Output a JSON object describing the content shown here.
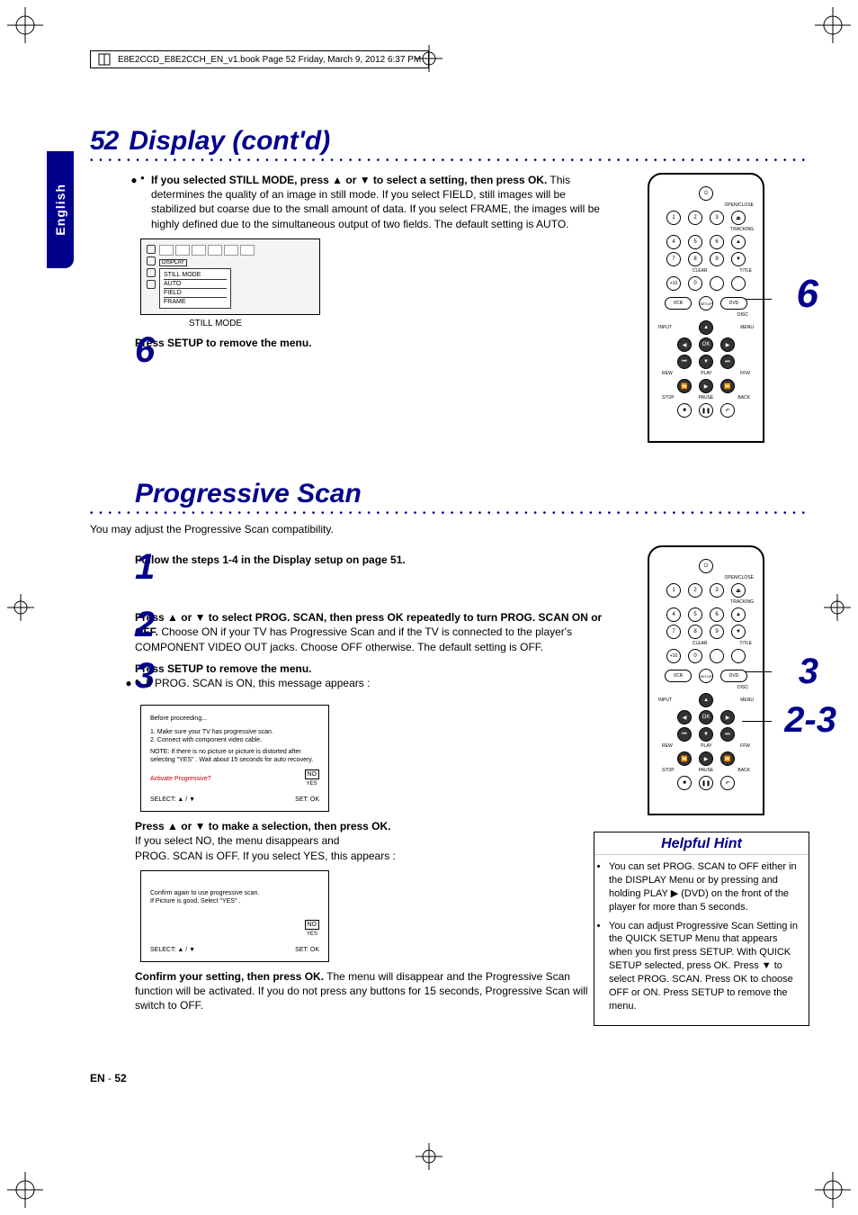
{
  "file_header": "E8E2CCD_E8E2CCH_EN_v1.book  Page 52  Friday, March 9, 2012  6:37 PM",
  "lang_tab": "English",
  "page_number": "52",
  "footer": {
    "prefix": "EN",
    "sep": " - ",
    "num": "52"
  },
  "section1": {
    "title": "Display (cont'd)",
    "bullet_bold": "If you selected STILL MODE, press ▲ or ▼ to select a setting, then press OK.",
    "bullet_rest": " This determines the quality of an image in still mode. If you select FIELD, still images will be stabilized but coarse due to the small amount of data. If you select FRAME, the images will be highly defined due to the simultaneous output of two fields. The default setting is AUTO.",
    "osd": {
      "header": "DISPLAY",
      "items": [
        "STILL MODE",
        "AUTO",
        "FIELD",
        "FRAME"
      ]
    },
    "osd_caption": "STILL MODE",
    "step6": "Press SETUP to remove the menu."
  },
  "section2": {
    "title": "Progressive Scan",
    "intro": "You may adjust the Progressive Scan compatibility.",
    "step1": "Follow the steps 1-4 in the Display setup on page 51.",
    "step2_bold": "Press ▲ or ▼ to select PROG. SCAN, then press OK repeatedly to turn PROG. SCAN ON or OFF.",
    "step2_rest": " Choose ON if your TV has Progressive Scan and if the TV is connected to the player's COMPONENT VIDEO OUT jacks. Choose OFF otherwise. The default setting is OFF.",
    "step3_bold": "Press SETUP to remove the menu.",
    "step3_bullet": "If PROG. SCAN is ON, this message appears :",
    "msg1": {
      "l1": "Before proceeding...",
      "l2": "1. Make sure your TV has progressive scan.",
      "l3": "2. Connect with component video cable.",
      "l4": "NOTE:  If there is no picture or picture is distorted after selecting \"YES\" . Wait about 15 seconds for auto recovery.",
      "l5": "Activate Progressive?",
      "opt1": "NO",
      "opt2": "YES",
      "select": "SELECT:  ▲ / ▼",
      "set": "SET: OK"
    },
    "after_msg1_bold": "Press ▲ or ▼ to make a selection, then press OK.",
    "after_msg1_l1": "If you select NO, the menu disappears and",
    "after_msg1_l2": "PROG. SCAN is OFF. If you select YES, this appears :",
    "msg2": {
      "l1": "Confirm again to use progressive scan.",
      "l2": "If Picture is good, Select \"YES\" .",
      "opt1": "NO",
      "opt2": "YES",
      "select": "SELECT:  ▲ / ▼",
      "set": "SET: OK"
    },
    "confirm_bold": "Confirm your setting, then press OK.",
    "confirm_rest": " The menu will disappear and the Progressive Scan function will be activated. If you do not press any buttons for 15 seconds, Progressive Scan will switch to OFF."
  },
  "remote": {
    "open_close": "OPEN/CLOSE",
    "tracking": "TRACKING",
    "clear": "CLEAR",
    "title": "TITLE",
    "vcr": "VCR",
    "setup": "SETUP",
    "dvd": "DVD",
    "disc": "DISC",
    "input": "INPUT",
    "menu": "MENU",
    "ok": "OK",
    "rew": "REW",
    "play": "PLAY",
    "ffw": "FFW",
    "stop": "STOP",
    "pause": "PAUSE",
    "back": "BACK",
    "plus10": "+10",
    "nums": [
      "1",
      "2",
      "3",
      "4",
      "5",
      "6",
      "7",
      "8",
      "9",
      "0"
    ]
  },
  "callouts": {
    "s1_right": "6",
    "s1_left": "6",
    "s2_right_top": "3",
    "s2_right_bottom": "2-3"
  },
  "hint": {
    "title": "Helpful Hint",
    "items": [
      "You can set PROG. SCAN to OFF either in the DISPLAY Menu or by pressing and holding PLAY ▶ (DVD) on the front of the player for more than 5 seconds.",
      "You can adjust Progressive Scan Setting in the QUICK SETUP Menu that appears when you first press SETUP. With QUICK SETUP selected, press OK. Press ▼ to select PROG. SCAN. Press OK to choose OFF or ON. Press SETUP to remove the menu."
    ]
  }
}
